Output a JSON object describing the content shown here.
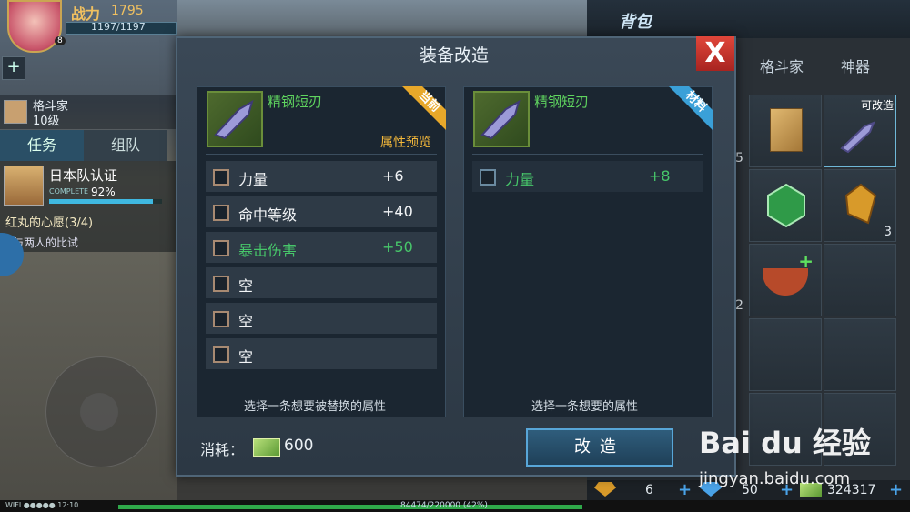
{
  "hud": {
    "power_label": "战力",
    "power_value": "1795",
    "hp_text": "1197/1197",
    "level_badge": "8",
    "fighter_name": "格斗家",
    "fighter_level": "10级",
    "tab_task": "任务",
    "tab_team": "组队",
    "task_title": "日本队认证",
    "task_complete": "COMPLETE",
    "task_percent": "92%",
    "task_progress": 0.92,
    "quest_name": "红丸的心愿(3/4)",
    "quest_desc": "与两人的比试",
    "wifi": "WIFI ●●●●● 12:10",
    "exp_text": "84474/220000 (42%)"
  },
  "bag": {
    "title": "背包",
    "tabs": [
      "格斗家",
      "神器"
    ],
    "upgradable_tag": "可改造",
    "counts": [
      "5",
      "3",
      "2"
    ],
    "currency": [
      {
        "value": "6"
      },
      {
        "value": "50"
      },
      {
        "value": "324317"
      }
    ]
  },
  "modal": {
    "title": "装备改造",
    "close_label": "X",
    "left": {
      "item_name": "精钢短刃",
      "ribbon": "当前",
      "preview_label": "属性预览",
      "attributes": [
        {
          "name": "力量",
          "value": "+6",
          "green": false
        },
        {
          "name": "命中等级",
          "value": "+40",
          "green": false
        },
        {
          "name": "暴击伤害",
          "value": "+50",
          "green": true
        },
        {
          "name": "空",
          "value": "",
          "green": false
        },
        {
          "name": "空",
          "value": "",
          "green": false
        },
        {
          "name": "空",
          "value": "",
          "green": false
        }
      ],
      "hint": "选择一条想要被替换的属性"
    },
    "right": {
      "item_name": "精钢短刃",
      "ribbon": "材料",
      "attributes": [
        {
          "name": "力量",
          "value": "+8",
          "green": true
        }
      ],
      "hint": "选择一条想要的属性"
    },
    "cost_label": "消耗：",
    "cost_value": "600",
    "reforge_button": "改造"
  },
  "watermark": {
    "brand": "Bai du 经验",
    "url": "jingyan.baidu.com"
  },
  "colors": {
    "green_text": "#47c66a",
    "orange_text": "#f2b73a",
    "ribbon_current": "#e8a82a",
    "ribbon_material": "#3aa0d8",
    "close_red": "#d03a30"
  }
}
